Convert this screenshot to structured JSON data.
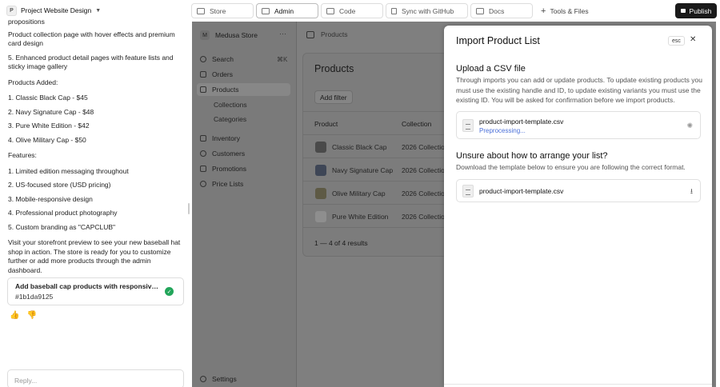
{
  "project": {
    "badge": "P",
    "name": "Project Website Design"
  },
  "chat": {
    "lines_a": [
      "propositions",
      "Product collection page with hover effects and premium card design",
      "5. Enhanced product detail pages with feature lists and sticky image gallery"
    ],
    "products_heading": "Products Added:",
    "products": [
      "1. Classic Black Cap - $45",
      "2. Navy Signature Cap - $48",
      "3. Pure White Edition - $42",
      "4. Olive Military Cap - $50"
    ],
    "features_heading": "Features:",
    "features": [
      "1. Limited edition messaging throughout",
      "2. US-focused store (USD pricing)",
      "3. Mobile-responsive design",
      "4. Professional product photography",
      "5. Custom branding as \"CAPCLUB\""
    ],
    "closing": "Visit your storefront preview to see your new baseball hat shop in action. The store is ready for you to customize further or add more products through the admin dashboard.",
    "commit_title": "Add baseball cap products with responsive g...",
    "commit_hash": "#1b1da9125",
    "reply_placeholder": "Reply..."
  },
  "top_tabs": [
    "Store",
    "Admin",
    "Code",
    "Sync with GitHub",
    "Docs"
  ],
  "tools_label": "Tools & Files",
  "publish_label": "Publish",
  "admin": {
    "store_badge": "M",
    "store_name": "Medusa Store",
    "search_label": "Search",
    "search_kbd": "⌘K",
    "nav": [
      "Orders",
      "Products",
      "Inventory",
      "Customers",
      "Promotions",
      "Price Lists"
    ],
    "sub_nav": [
      "Collections",
      "Categories"
    ],
    "settings_label": "Settings",
    "breadcrumb": "Products",
    "page_title": "Products",
    "add_filter": "Add filter",
    "columns": [
      "Product",
      "Collection"
    ],
    "rows": [
      {
        "name": "Classic Black Cap",
        "collection": "2026 Collection"
      },
      {
        "name": "Navy Signature Cap",
        "collection": "2026 Collection"
      },
      {
        "name": "Olive Military Cap",
        "collection": "2026 Collection"
      },
      {
        "name": "Pure White Edition",
        "collection": "2026 Collection"
      }
    ],
    "pager": "1 — 4 of 4 results"
  },
  "modal": {
    "title": "Import Product List",
    "esc": "esc",
    "upload_heading": "Upload a CSV file",
    "upload_desc": "Through imports you can add or update products. To update existing products you must use the existing handle and ID, to update existing variants you must use the existing ID. You will be asked for confirmation before we import products.",
    "file1_name": "product-import-template.csv",
    "file1_status": "Preprocessing...",
    "unsure_heading": "Unsure about how to arrange your list?",
    "unsure_desc": "Download the template below to ensure you are following the correct format.",
    "file2_name": "product-import-template.csv"
  }
}
